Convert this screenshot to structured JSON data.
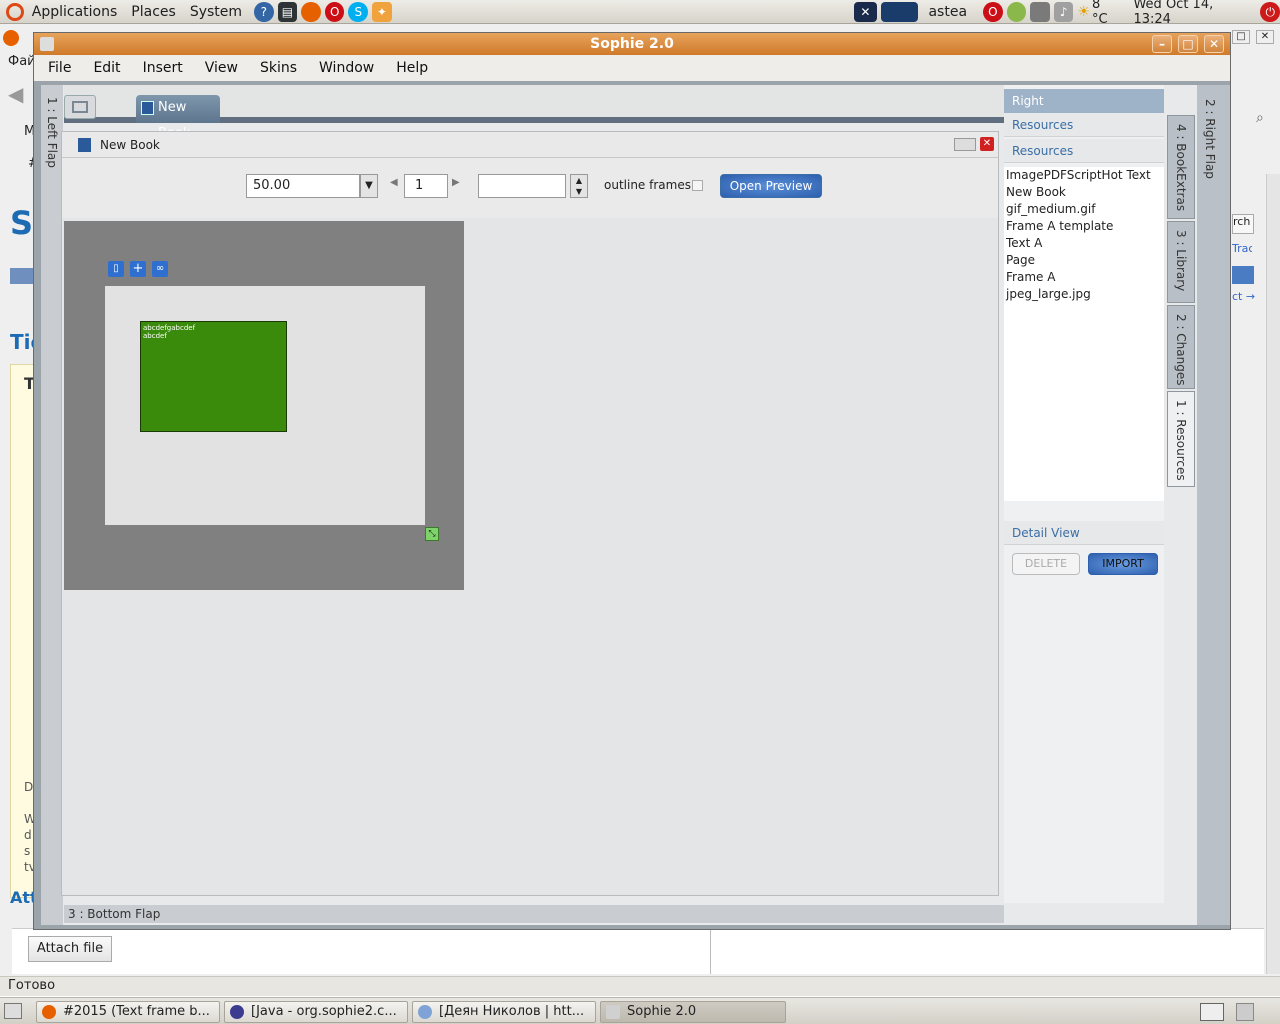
{
  "top_panel": {
    "menus": [
      "Applications",
      "Places",
      "System"
    ],
    "user": "astea",
    "weather": "8 °C",
    "clock": "Wed Oct 14, 13:24"
  },
  "background_browser": {
    "partial_texts": [
      "Фай",
      "M",
      "#",
      "Tic",
      "T",
      "D",
      "W",
      "d",
      "s",
      "tv",
      "Att"
    ],
    "right_partial": [
      "rch",
      "Trac",
      "ct →"
    ],
    "attach_button": "Attach file",
    "status": "Готово"
  },
  "taskbar": {
    "items": [
      {
        "label": "#2015 (Text frame b...",
        "active": false
      },
      {
        "label": "[Java - org.sophie2.c...",
        "active": false
      },
      {
        "label": "[Деян Николов | htt...",
        "active": false
      },
      {
        "label": "Sophie 2.0",
        "active": true
      }
    ]
  },
  "window": {
    "title": "Sophie 2.0",
    "menu": [
      "File",
      "Edit",
      "Insert",
      "View",
      "Skins",
      "Window",
      "Help"
    ],
    "left_flap": "1 : Left Flap",
    "bottom_flap": "3 : Bottom Flap",
    "right_flap": "2 : Right Flap",
    "book_tab": "New Book",
    "document": {
      "title": "New Book",
      "zoom_value": "50.00",
      "page_number": "1",
      "spinner_value": "",
      "outline_frames_label": "outline frames",
      "outline_frames_checked": false,
      "preview_button": "Open Preview",
      "frame_color": "#3a8a0b",
      "frame_text": "abcdefgabcdef abcdef"
    },
    "right_panel": {
      "title": "Right",
      "resources_outer": "Resources",
      "resources_inner": "Resources",
      "resource_items": [
        "ImagePDFScriptHot Text",
        "New Book",
        "gif_medium.gif",
        "Frame A template",
        "Text A",
        "Page",
        "Frame A",
        "jpeg_large.jpg"
      ],
      "detail_view": "Detail View",
      "delete_button": "DELETE",
      "import_button": "IMPORT"
    },
    "vertical_tabs": [
      "4 : BookExtras",
      "3 : Library",
      "2 : Changes",
      "1 : Resources"
    ]
  },
  "colors": {
    "title_bar": "#d98c3f",
    "accent_blue": "#3a6ea5",
    "frame_green": "#3a8a0b",
    "canvas_grey": "#808080"
  }
}
